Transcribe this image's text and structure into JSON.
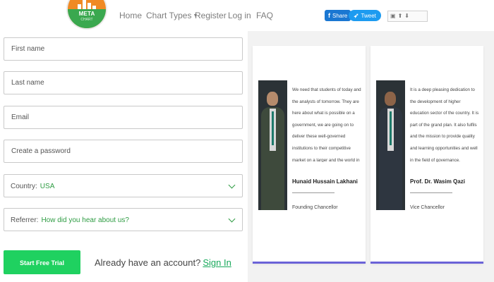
{
  "logo": {
    "text": "META",
    "subtext": "CHART"
  },
  "nav": {
    "items": [
      {
        "label": "Home"
      },
      {
        "label": "Chart Types"
      },
      {
        "label": "Register"
      },
      {
        "label": "Log in"
      },
      {
        "label": "FAQ"
      }
    ]
  },
  "social": {
    "share_label": "Share",
    "tweet_label": "Tweet"
  },
  "form": {
    "first_name_placeholder": "First name",
    "last_name_placeholder": "Last name",
    "email_placeholder": "Email",
    "password_placeholder": "Create a password",
    "country_label": "Country:",
    "country_value": "USA",
    "referrer_label": "Referrer:",
    "referrer_value": "How did you hear about us?",
    "submit_label": "Start Free Trial"
  },
  "signin": {
    "prompt": "Already have an account?",
    "link": "Sign In"
  },
  "testimonials": [
    {
      "quote": "We need that students of today and the analysts of tomorrow. They are here about what is possible on a government, we are going on to deliver these well-governed institutions to their competitive market on a larger and the world in front of the success.",
      "name": "Hunaid Hussain Lakhani",
      "title": "Founding Chancellor"
    },
    {
      "quote": "It is a deep pleasing dedication to the development of higher education sector of the country. It is part of the grand plan. It also fulfils and the mission to provide quality and learning opportunities and well in the field of governance.",
      "name": "Prof. Dr. Wasim Qazi",
      "title": "Vice Chancellor"
    }
  ]
}
